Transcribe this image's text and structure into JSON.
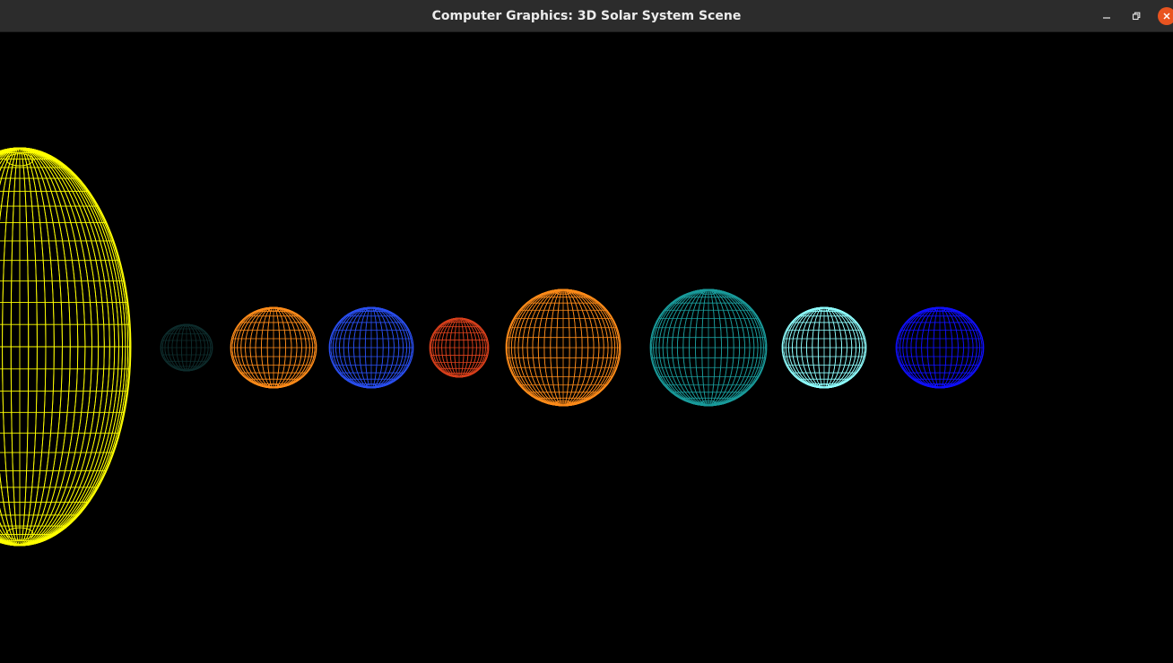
{
  "window": {
    "title": "Computer Graphics: 3D Solar System Scene",
    "controls": [
      "minimize",
      "maximize",
      "close"
    ]
  },
  "scene": {
    "background": "#000000",
    "render_mode": "wireframe",
    "bodies": [
      {
        "name": "sun",
        "color": "#ffff00"
      },
      {
        "name": "planet-1",
        "color": "#0e2d2d"
      },
      {
        "name": "planet-2",
        "color": "#ff8c1a"
      },
      {
        "name": "planet-3",
        "color": "#2a4ff0"
      },
      {
        "name": "planet-4",
        "color": "#d9401c"
      },
      {
        "name": "planet-5",
        "color": "#ff8c1a"
      },
      {
        "name": "planet-6",
        "color": "#1a9c9c"
      },
      {
        "name": "planet-7",
        "color": "#8fffff"
      },
      {
        "name": "planet-8",
        "color": "#1010ff"
      }
    ]
  }
}
